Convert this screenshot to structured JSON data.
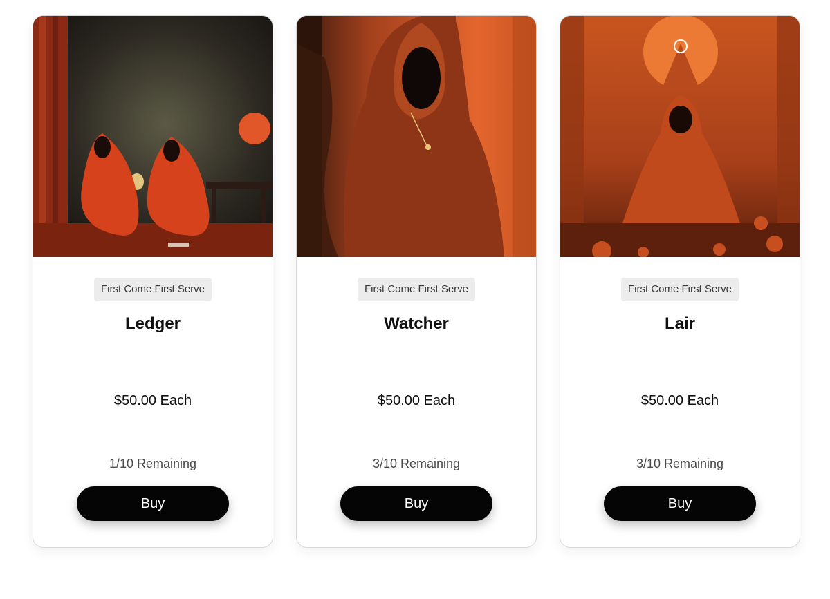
{
  "products": [
    {
      "badge": "First Come First Serve",
      "name": "Ledger",
      "price": "$50.00 Each",
      "remaining": "1/10 Remaining",
      "buy_label": "Buy",
      "image": "two-red-hooded-figures-in-parlor"
    },
    {
      "badge": "First Come First Serve",
      "name": "Watcher",
      "price": "$50.00 Each",
      "remaining": "3/10 Remaining",
      "buy_label": "Buy",
      "image": "hooded-figure-orange-backdrop"
    },
    {
      "badge": "First Come First Serve",
      "name": "Lair",
      "price": "$50.00 Each",
      "remaining": "3/10 Remaining",
      "buy_label": "Buy",
      "image": "seated-hooded-figure-under-sun"
    }
  ],
  "colors": {
    "button": "#050505",
    "badge_bg": "#ececec",
    "accent_orange": "#e2572a"
  }
}
